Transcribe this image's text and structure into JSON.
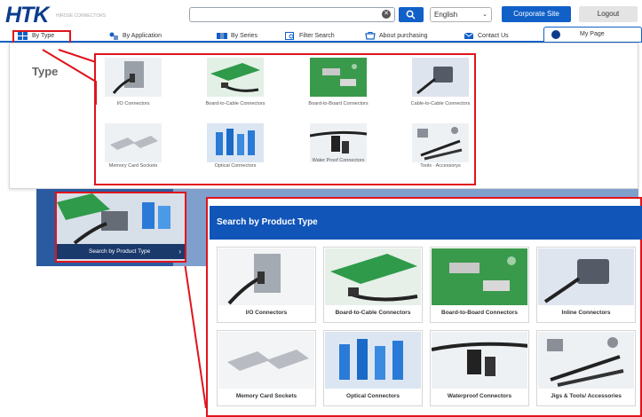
{
  "header": {
    "logo": "HTK",
    "logo_tagline": "HIROSE CONNECTORS",
    "search_value": "",
    "language": "English",
    "corporate_site": "Corporate Site",
    "logout": "Logout"
  },
  "nav": {
    "items": [
      {
        "label": "By Type",
        "icon": "grid-icon"
      },
      {
        "label": "By Application",
        "icon": "application-icon"
      },
      {
        "label": "By Series",
        "icon": "series-icon"
      },
      {
        "label": "Filter Search",
        "icon": "filter-icon"
      },
      {
        "label": "About purchasing",
        "icon": "cart-icon"
      },
      {
        "label": "Contact Us",
        "icon": "mail-icon"
      }
    ],
    "my_page": "My Page"
  },
  "dropdown": {
    "section_label": "Type",
    "items": [
      {
        "label": "I/O Connectors"
      },
      {
        "label": "Board-to-Cable Connectors"
      },
      {
        "label": "Board-to-Board Connectors"
      },
      {
        "label": "Cable-to-Cable Connectors"
      },
      {
        "label": "Memory Card Sockets"
      },
      {
        "label": "Optical Connectors"
      },
      {
        "label": "Water Proof Connectors"
      },
      {
        "label": "Tools · Accessorys"
      }
    ]
  },
  "banner": {
    "card_label": "Search by Product Type",
    "arrow": "›"
  },
  "product_panel": {
    "title": "Search by Product Type",
    "items": [
      {
        "label": "I/O Connectors"
      },
      {
        "label": "Board-to-Cable Connectors"
      },
      {
        "label": "Board-to-Board Connectors"
      },
      {
        "label": "Inline Connectors"
      },
      {
        "label": "Memory Card Sockets"
      },
      {
        "label": "Optical Connectors"
      },
      {
        "label": "Waterproof Connectors"
      },
      {
        "label": "Jigs & Tools/ Accessories"
      }
    ]
  },
  "colors": {
    "brand_blue": "#1160c8",
    "logo_navy": "#0c3c8c",
    "highlight_red": "#e0141c",
    "panel_header": "#1155b8"
  }
}
